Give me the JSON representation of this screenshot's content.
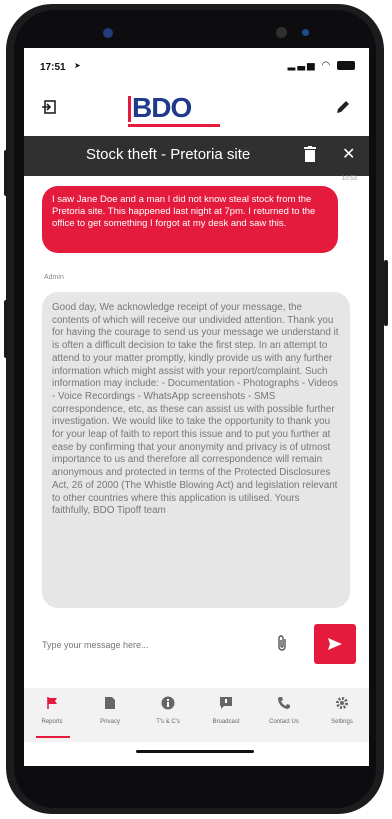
{
  "status": {
    "time": "17:51",
    "icons": [
      "location-arrow-icon",
      "signal-icon",
      "wifi-icon",
      "battery-icon"
    ]
  },
  "header": {
    "logo": "BDO",
    "left_icon": "login-icon",
    "right_icon": "pencil-icon"
  },
  "chat": {
    "title": "Stock theft - Pretoria site",
    "timestamp": "10:53",
    "user_message": "I saw Jane Doe and a man I did not know steal stock from the Pretoria site. This happened last night at 7pm. I returned to the office to get something I forgot at my desk and saw this.",
    "sender": "Admin",
    "admin_message": "Good day, We acknowledge receipt of your message, the contents of which will receive our undivided attention. Thank you for having the courage to send us your message we understand it is often a difficult decision to take the first step. In an attempt to attend to your matter promptly, kindly provide us with any further information which might assist with your report/complaint. Such information may include: - Documentation - Photographs - Videos - Voice Recordings - WhatsApp screenshots - SMS correspondence, etc, as these can assist us with possible further investigation. We would like to take the opportunity to thank you for your leap of faith to report this issue and to put you further at ease by confirming that your anonymity and privacy is of utmost importance to us and therefore all correspondence will remain anonymous and protected in terms of the Protected Disclosures Act, 26 of 2000 (The Whistle Blowing Act) and legislation relevant to other countries where this application is utilised. Yours faithfully, BDO Tipoff team"
  },
  "composer": {
    "placeholder": "Type your message here..."
  },
  "tabs": [
    {
      "label": "Reports",
      "icon": "flag-icon"
    },
    {
      "label": "Privacy",
      "icon": "document-icon"
    },
    {
      "label": "T's & C's",
      "icon": "info-icon"
    },
    {
      "label": "Broadcast",
      "icon": "broadcast-icon"
    },
    {
      "label": "Contact Us",
      "icon": "phone-icon"
    },
    {
      "label": "Settings",
      "icon": "gear-icon"
    }
  ],
  "colors": {
    "accent": "#e51b3e",
    "brand_blue": "#1f3a8a",
    "titlebar": "#303030"
  }
}
